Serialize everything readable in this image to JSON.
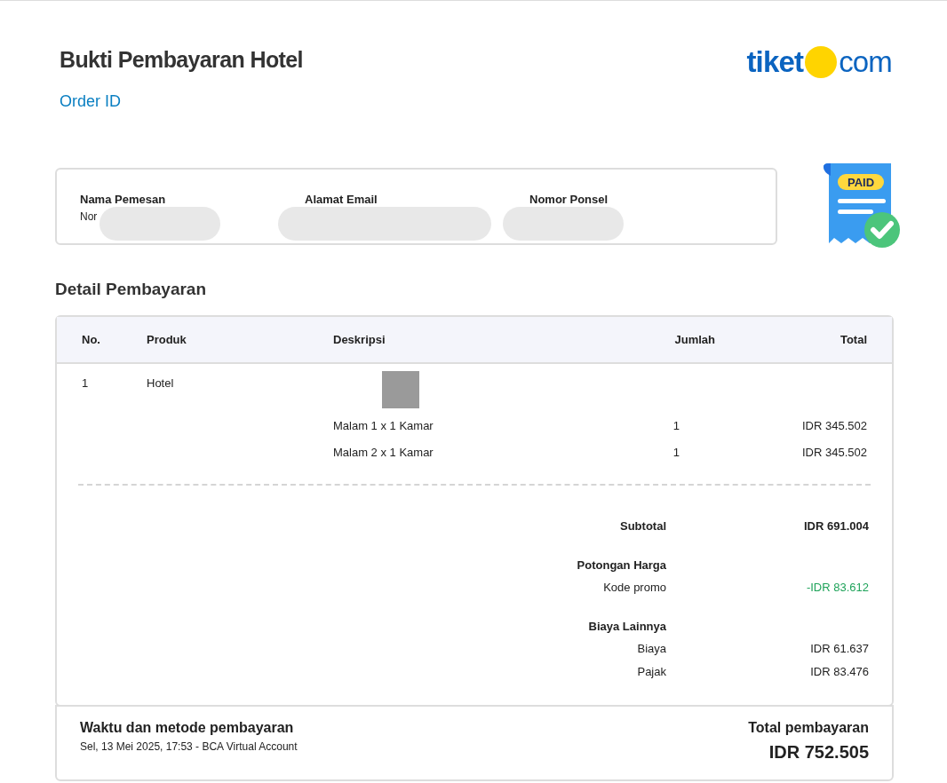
{
  "header": {
    "title": "Bukti Pembayaran Hotel",
    "order_id_label": "Order ID",
    "logo": {
      "left": "tiket",
      "right": "com"
    }
  },
  "customer": [
    {
      "label": "Nama Pemesan",
      "value": "Nor"
    },
    {
      "label": "Alamat Email"
    },
    {
      "label": "Nomor Ponsel"
    }
  ],
  "paid_badge": "PAID",
  "section_title": "Detail Pembayaran",
  "table": {
    "columns": [
      "No.",
      "Produk",
      "Deskripsi",
      "Jumlah",
      "Total"
    ],
    "rows": [
      {
        "no": "1",
        "product": "Hotel",
        "lines": [
          {
            "description": "Malam 1 x 1 Kamar",
            "qty": "1",
            "total": "IDR 345.502"
          },
          {
            "description": "Malam 2 x 1 Kamar",
            "qty": "1",
            "total": "IDR 345.502"
          }
        ]
      }
    ]
  },
  "summary": [
    {
      "kind": "row",
      "label": "Subtotal",
      "value": "IDR 691.004",
      "bold": true
    },
    {
      "kind": "heading",
      "label": "Potongan Harga"
    },
    {
      "kind": "row",
      "label": "Kode promo",
      "value": "-IDR 83.612",
      "discount": true
    },
    {
      "kind": "heading",
      "label": "Biaya Lainnya"
    },
    {
      "kind": "row",
      "label": "Biaya",
      "value": "IDR 61.637"
    },
    {
      "kind": "row",
      "label": "Pajak",
      "value": "IDR 83.476"
    }
  ],
  "footer": {
    "method_title": "Waktu dan metode pembayaran",
    "method_detail": "Sel, 13 Mei 2025, 17:53 - BCA Virtual Account",
    "total_label": "Total pembayaran",
    "total_value": "IDR 752.505"
  }
}
